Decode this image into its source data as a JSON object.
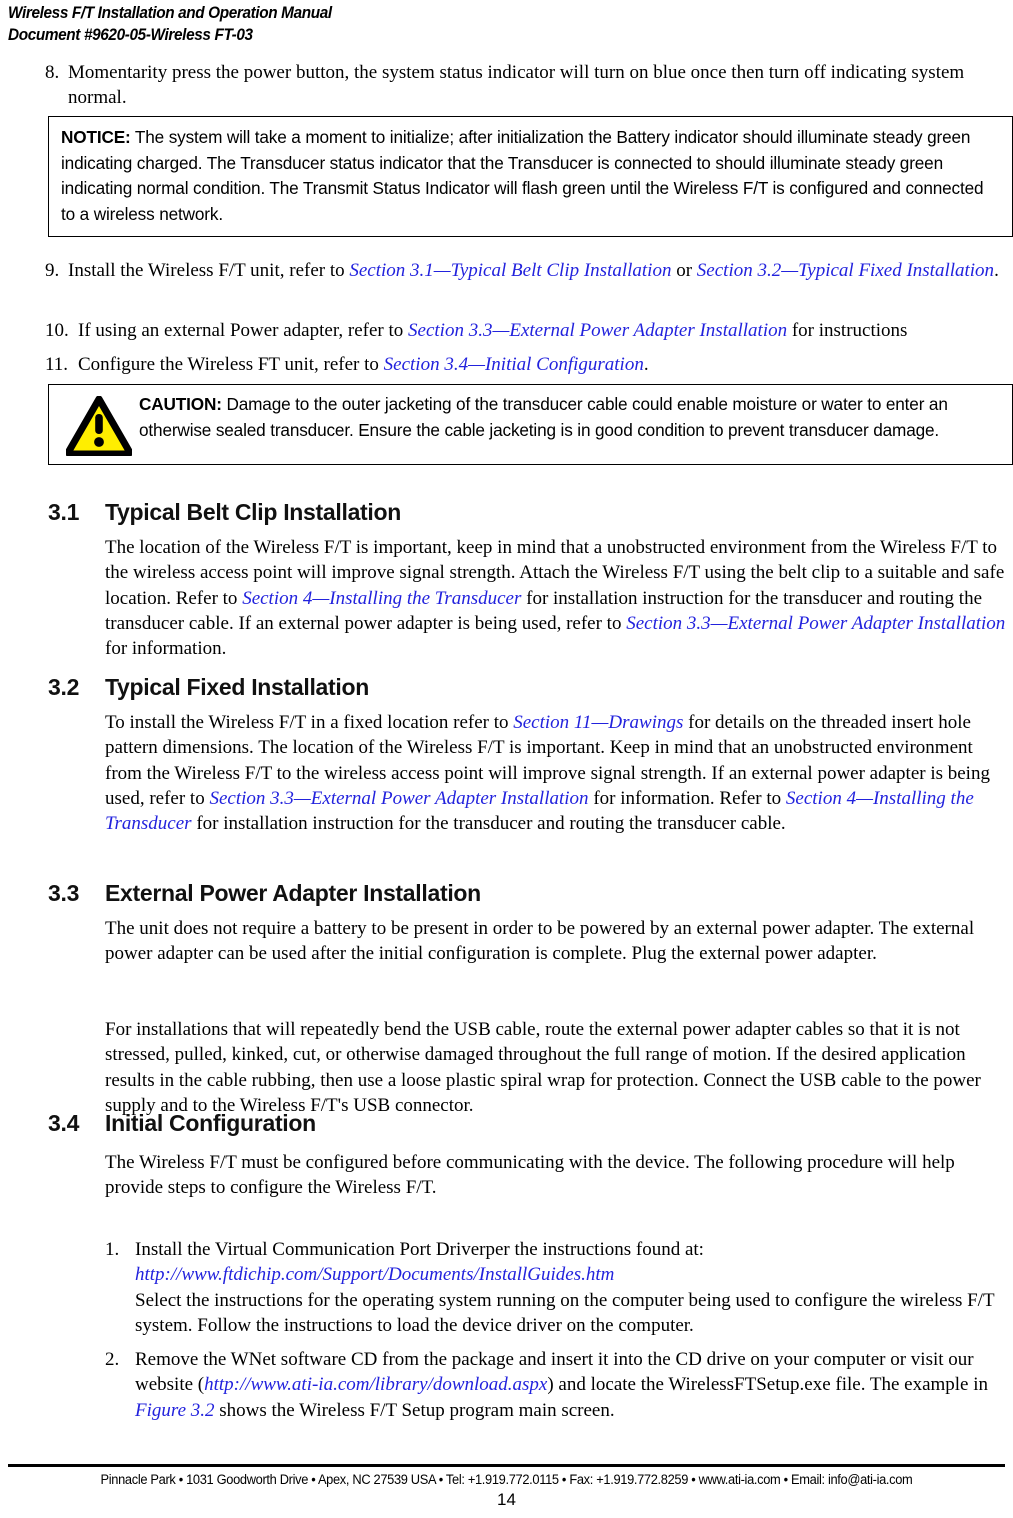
{
  "header": {
    "title": "Wireless F/T Installation and Operation Manual",
    "document": "Document #9620-05-Wireless FT-03"
  },
  "colors": {
    "link": "#2222dd",
    "warning_triangle_fill": "#ffee00",
    "warning_triangle_stroke": "#000000",
    "text": "#000000"
  },
  "main_list": [
    {
      "marker": "8.",
      "text": "Momentarity press the power button, the system status indicator will turn on blue once then turn off indicating system normal."
    },
    {
      "marker": "9.",
      "pre": "Install the Wireless F/T unit, refer to ",
      "link1": "Section 3.1—Typical Belt Clip Installation",
      "mid": " or ",
      "link2": "Section 3.2—Typical Fixed Installation",
      "post": "."
    },
    {
      "marker": "10.",
      "pre": "If using an external Power adapter, refer to ",
      "link1": "Section 3.3—External Power Adapter Installation",
      "post": " for instructions"
    },
    {
      "marker": "11.",
      "pre": "Configure the Wireless FT unit, refer to ",
      "link1": "Section 3.4—Initial Configuration",
      "post": "."
    }
  ],
  "notice_box": {
    "label": "NOTICE:",
    "text": " The system will take a moment to initialize; after initialization the Battery indicator should illuminate steady green indicating charged. The Transducer status indicator that the Transducer is connected to should illuminate steady green indicating normal condition. The Transmit Status Indicator will flash green until the Wireless F/T is configured and connected to a wireless network."
  },
  "caution_box": {
    "icon": "warning-triangle-icon",
    "label": "CAUTION:",
    "text": " Damage to the outer jacketing of the transducer cable could enable moisture or water to enter an otherwise sealed transducer. Ensure the cable jacketing is in good condition to prevent transducer damage."
  },
  "sections": {
    "s31": {
      "number": "3.1",
      "title": "Typical Belt Clip Installation",
      "p1_a": "The location of the Wireless F/T is important, keep in mind that a unobstructed environment from the Wireless F/T to the wireless access point will improve signal strength. Attach the Wireless F/T using the belt clip to a suitable and safe location. Refer to ",
      "p1_link1": "Section 4—Installing the Transducer",
      "p1_b": " for installation instruction for the transducer and routing the transducer cable. If an external power adapter is being used, refer to ",
      "p1_link2": "Section 3.3—External Power Adapter Installation",
      "p1_c": " for information."
    },
    "s32": {
      "number": "3.2",
      "title": "Typical Fixed Installation",
      "p1_a": "To install the Wireless F/T in a fixed location refer to ",
      "p1_link1": "Section 11—Drawings",
      "p1_b": " for details on the threaded insert hole pattern dimensions. The location of the Wireless F/T is important. Keep in mind that an unobstructed environment from the Wireless F/T to the wireless access point will improve signal strength. If an external power adapter is being used, refer to ",
      "p1_link2": "Section 3.3—External Power Adapter Installation",
      "p1_c": " for information. Refer to ",
      "p1_link3": "Section 4—Installing the Transducer",
      "p1_d": " for installation instruction for the transducer and routing the transducer cable."
    },
    "s33": {
      "number": "3.3",
      "title": "External Power Adapter Installation",
      "p1": "The unit does not require a battery to be present in order to be powered by an external power adapter. The external power adapter can be used after the initial configuration is complete. Plug the external power adapter.",
      "p2": "For installations that will repeatedly bend the USB cable, route the external power adapter cables so that it is not stressed, pulled, kinked, cut, or otherwise damaged throughout the full range of motion. If the desired application results in the cable rubbing, then use a loose plastic spiral wrap for protection. Connect the USB cable to the power supply and to the Wireless F/T's USB connector."
    },
    "s34": {
      "number": "3.4",
      "title": "Initial Configuration",
      "p1": "The Wireless F/T must be configured before communicating with the device. The following procedure will help provide steps to configure the Wireless F/T.",
      "steps": [
        {
          "marker": "1.",
          "a": "Install the Virtual Communication Port Driverper the instructions found at:",
          "url": "http://www.ftdichip.com/Support/Documents/InstallGuides.htm",
          "b": "Select the instructions for the operating system running on the computer being used to configure the wireless F/T system. Follow the instructions to load the device driver on the computer."
        },
        {
          "marker": "2.",
          "a": "Remove the WNet software CD from the package and insert it into the CD drive on your computer or visit our website (",
          "url": "http://www.ati-ia.com/library/download.aspx",
          "b": ") and locate the WirelessFTSetup.exe file. The example in ",
          "figref": "Figure 3.2",
          "c": " shows the Wireless F/T Setup program main screen."
        }
      ]
    }
  },
  "footer": {
    "address": "Pinnacle Park • 1031 Goodworth Drive • Apex, NC 27539 USA • Tel: +1.919.772.0115 • Fax: +1.919.772.8259 • www.ati-ia.com • Email: info@ati-ia.com",
    "page_number": "14"
  }
}
